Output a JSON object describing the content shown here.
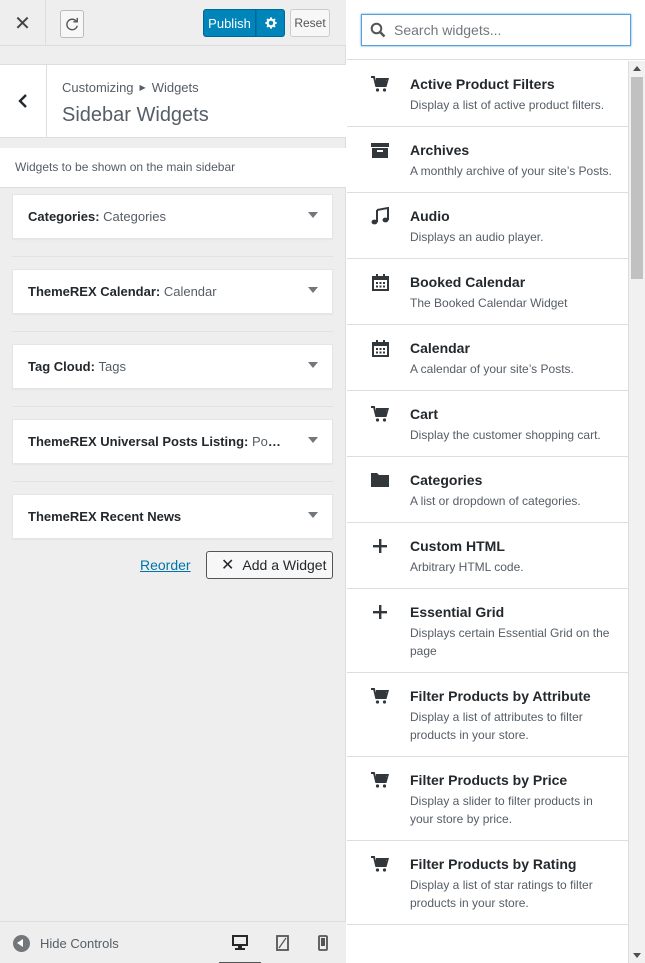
{
  "colors": {
    "primary": "#0085ba",
    "link": "#0073aa",
    "text": "#23282d",
    "muted": "#555d66"
  },
  "topbar": {
    "publish_label": "Publish",
    "reset_label": "Reset"
  },
  "section": {
    "breadcrumb_parent": "Customizing",
    "breadcrumb_current": "Widgets",
    "title": "Sidebar Widgets",
    "description": "Widgets to be shown on the main sidebar"
  },
  "widgets": [
    {
      "name": "Categories",
      "subtitle": "Categories"
    },
    {
      "name": "ThemeREX Calendar",
      "subtitle": "Calendar"
    },
    {
      "name": "Tag Cloud",
      "subtitle": "Tags"
    },
    {
      "name": "ThemeREX Universal Posts Listing",
      "subtitle": "Pop..."
    },
    {
      "name": "ThemeREX Recent News",
      "subtitle": ""
    }
  ],
  "actions": {
    "reorder_label": "Reorder",
    "add_widget_label": "Add a Widget"
  },
  "footer": {
    "hide_controls_label": "Hide Controls"
  },
  "search": {
    "placeholder": "Search widgets..."
  },
  "available_widgets": [
    {
      "icon": "cart-icon",
      "name": "Active Product Filters",
      "desc": "Display a list of active product filters."
    },
    {
      "icon": "archive-icon",
      "name": "Archives",
      "desc": "A monthly archive of your site’s Posts."
    },
    {
      "icon": "music-note-icon",
      "name": "Audio",
      "desc": "Displays an audio player."
    },
    {
      "icon": "calendar-icon",
      "name": "Booked Calendar",
      "desc": "The Booked Calendar Widget"
    },
    {
      "icon": "calendar-icon",
      "name": "Calendar",
      "desc": "A calendar of your site’s Posts."
    },
    {
      "icon": "cart-icon",
      "name": "Cart",
      "desc": "Display the customer shopping cart."
    },
    {
      "icon": "folder-icon",
      "name": "Categories",
      "desc": "A list or dropdown of categories."
    },
    {
      "icon": "plus-icon",
      "name": "Custom HTML",
      "desc": "Arbitrary HTML code."
    },
    {
      "icon": "plus-icon",
      "name": "Essential Grid",
      "desc": "Displays certain Essential Grid on the page"
    },
    {
      "icon": "cart-icon",
      "name": "Filter Products by Attribute",
      "desc": "Display a list of attributes to filter products in your store."
    },
    {
      "icon": "cart-icon",
      "name": "Filter Products by Price",
      "desc": "Display a slider to filter products in your store by price."
    },
    {
      "icon": "cart-icon",
      "name": "Filter Products by Rating",
      "desc": "Display a list of star ratings to filter products in your store."
    }
  ]
}
